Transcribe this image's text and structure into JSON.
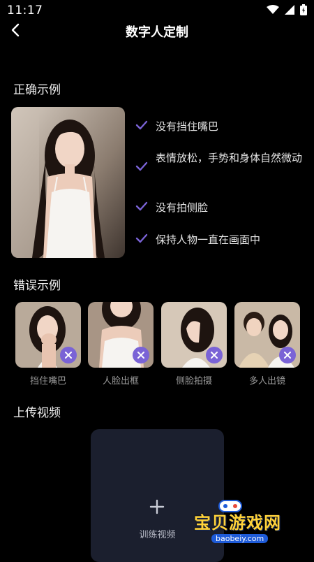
{
  "status": {
    "time": "11:17"
  },
  "header": {
    "title": "数字人定制"
  },
  "correct": {
    "title": "正确示例",
    "items": [
      "没有挡住嘴巴",
      "表情放松，手势和身体自然微动",
      "没有拍侧脸",
      "保持人物一直在画面中"
    ]
  },
  "wrong": {
    "title": "错误示例",
    "items": [
      {
        "label": "挡住嘴巴"
      },
      {
        "label": "人脸出框"
      },
      {
        "label": "侧脸拍摄"
      },
      {
        "label": "多人出镜"
      }
    ]
  },
  "upload": {
    "title": "上传视频",
    "button_label": "训练视频"
  },
  "watermark": {
    "text": "宝贝游戏网",
    "url": "baobeiy.com"
  },
  "colors": {
    "accent": "#7a63d6",
    "background": "#000000",
    "upload_bg": "#1b1f2e"
  }
}
